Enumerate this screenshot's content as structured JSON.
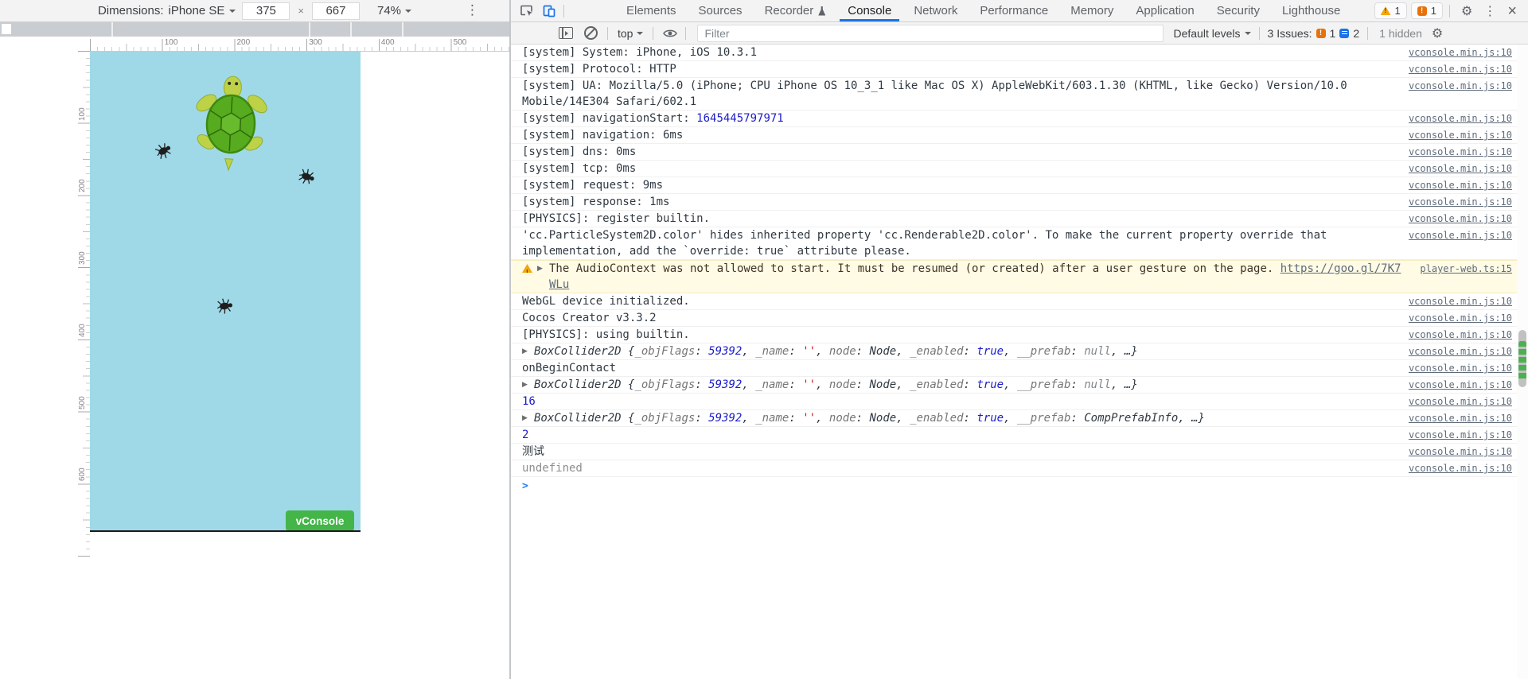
{
  "device_toolbar": {
    "dimensions_label": "Dimensions:",
    "device_name": "iPhone SE",
    "width": "375",
    "height": "667",
    "zoom": "74%",
    "x_separator": "×"
  },
  "rulers": {
    "horizontal_labels": [
      "100",
      "200",
      "300",
      "400",
      "500"
    ],
    "vertical_labels": [
      "100",
      "200",
      "300",
      "400",
      "500",
      "600"
    ]
  },
  "game": {
    "vconsole_button": "vConsole",
    "canvas_color": "#9fd9e8",
    "button_color": "#44b549"
  },
  "devtools": {
    "tabs": [
      {
        "label": "Elements"
      },
      {
        "label": "Sources"
      },
      {
        "label": "Recorder",
        "experiment": true
      },
      {
        "label": "Console",
        "active": true
      },
      {
        "label": "Network"
      },
      {
        "label": "Performance"
      },
      {
        "label": "Memory"
      },
      {
        "label": "Application"
      },
      {
        "label": "Security"
      },
      {
        "label": "Lighthouse"
      }
    ],
    "warning_badge_count": "1",
    "issues_badge_count": "1",
    "toolbar": {
      "context": "top",
      "filter_placeholder": "Filter",
      "levels": "Default levels",
      "issues_label": "3 Issues:",
      "issues_warnings": "1",
      "issues_messages": "2",
      "hidden_label": "1 hidden"
    },
    "accent_color": "#1a73e8"
  },
  "console": {
    "prompt": ">",
    "messages": [
      {
        "kind": "log",
        "parts": [
          {
            "s": "p",
            "t": "[system] System: iPhone, iOS 10.3.1"
          }
        ],
        "source": "vconsole.min.js:10"
      },
      {
        "kind": "log",
        "parts": [
          {
            "s": "p",
            "t": "[system] Protocol: HTTP"
          }
        ],
        "source": "vconsole.min.js:10"
      },
      {
        "kind": "log",
        "parts": [
          {
            "s": "p",
            "t": "[system] UA: Mozilla/5.0 (iPhone; CPU iPhone OS 10_3_1 like Mac OS X) AppleWebKit/603.1.30 (KHTML, like Gecko) Version/10.0 Mobile/14E304 Safari/602.1"
          }
        ],
        "source": "vconsole.min.js:10"
      },
      {
        "kind": "log",
        "parts": [
          {
            "s": "p",
            "t": "[system] navigationStart: "
          },
          {
            "s": "num",
            "t": "1645445797971"
          }
        ],
        "source": "vconsole.min.js:10"
      },
      {
        "kind": "log",
        "parts": [
          {
            "s": "p",
            "t": "[system] navigation: 6ms"
          }
        ],
        "source": "vconsole.min.js:10"
      },
      {
        "kind": "log",
        "parts": [
          {
            "s": "p",
            "t": "[system] dns: 0ms"
          }
        ],
        "source": "vconsole.min.js:10"
      },
      {
        "kind": "log",
        "parts": [
          {
            "s": "p",
            "t": "[system] tcp: 0ms"
          }
        ],
        "source": "vconsole.min.js:10"
      },
      {
        "kind": "log",
        "parts": [
          {
            "s": "p",
            "t": "[system] request: 9ms"
          }
        ],
        "source": "vconsole.min.js:10"
      },
      {
        "kind": "log",
        "parts": [
          {
            "s": "p",
            "t": "[system] response: 1ms"
          }
        ],
        "source": "vconsole.min.js:10"
      },
      {
        "kind": "log",
        "parts": [
          {
            "s": "p",
            "t": "[PHYSICS]: register builtin."
          }
        ],
        "source": "vconsole.min.js:10"
      },
      {
        "kind": "log",
        "parts": [
          {
            "s": "p",
            "t": "'cc.ParticleSystem2D.color' hides inherited property 'cc.Renderable2D.color'. To make the current property override that implementation, add the `override: true` attribute please."
          }
        ],
        "source": "vconsole.min.js:10"
      },
      {
        "kind": "warn",
        "arrow": true,
        "parts": [
          {
            "s": "p",
            "t": "The AudioContext was not allowed to start. It must be resumed (or created) after a user gesture on the page. "
          },
          {
            "s": "link",
            "t": "https://goo.gl/7K7WLu"
          }
        ],
        "source": "player-web.ts:15"
      },
      {
        "kind": "log",
        "parts": [
          {
            "s": "p",
            "t": "WebGL device initialized."
          }
        ],
        "source": "vconsole.min.js:10"
      },
      {
        "kind": "log",
        "parts": [
          {
            "s": "p",
            "t": "Cocos Creator v3.3.2"
          }
        ],
        "source": "vconsole.min.js:10"
      },
      {
        "kind": "log",
        "parts": [
          {
            "s": "p",
            "t": "[PHYSICS]: using builtin."
          }
        ],
        "source": "vconsole.min.js:10"
      },
      {
        "kind": "obj",
        "arrow": true,
        "parts": [
          {
            "s": "cls",
            "t": "BoxCollider2D "
          },
          {
            "s": "p",
            "t": "{"
          },
          {
            "s": "key",
            "t": "_objFlags"
          },
          {
            "s": "p",
            "t": ": "
          },
          {
            "s": "num",
            "t": "59392"
          },
          {
            "s": "p",
            "t": ", "
          },
          {
            "s": "key",
            "t": "_name"
          },
          {
            "s": "p",
            "t": ": "
          },
          {
            "s": "str",
            "t": "''"
          },
          {
            "s": "p",
            "t": ", "
          },
          {
            "s": "key",
            "t": "node"
          },
          {
            "s": "p",
            "t": ": "
          },
          {
            "s": "cls",
            "t": "Node"
          },
          {
            "s": "p",
            "t": ", "
          },
          {
            "s": "key",
            "t": "_enabled"
          },
          {
            "s": "p",
            "t": ": "
          },
          {
            "s": "num",
            "t": "true"
          },
          {
            "s": "p",
            "t": ", "
          },
          {
            "s": "key",
            "t": "__prefab"
          },
          {
            "s": "p",
            "t": ": "
          },
          {
            "s": "nul",
            "t": "null"
          },
          {
            "s": "p",
            "t": ", …}"
          }
        ],
        "source": "vconsole.min.js:10"
      },
      {
        "kind": "log",
        "parts": [
          {
            "s": "p",
            "t": "onBeginContact"
          }
        ],
        "source": "vconsole.min.js:10"
      },
      {
        "kind": "obj",
        "arrow": true,
        "parts": [
          {
            "s": "cls",
            "t": "BoxCollider2D "
          },
          {
            "s": "p",
            "t": "{"
          },
          {
            "s": "key",
            "t": "_objFlags"
          },
          {
            "s": "p",
            "t": ": "
          },
          {
            "s": "num",
            "t": "59392"
          },
          {
            "s": "p",
            "t": ", "
          },
          {
            "s": "key",
            "t": "_name"
          },
          {
            "s": "p",
            "t": ": "
          },
          {
            "s": "str",
            "t": "''"
          },
          {
            "s": "p",
            "t": ", "
          },
          {
            "s": "key",
            "t": "node"
          },
          {
            "s": "p",
            "t": ": "
          },
          {
            "s": "cls",
            "t": "Node"
          },
          {
            "s": "p",
            "t": ", "
          },
          {
            "s": "key",
            "t": "_enabled"
          },
          {
            "s": "p",
            "t": ": "
          },
          {
            "s": "num",
            "t": "true"
          },
          {
            "s": "p",
            "t": ", "
          },
          {
            "s": "key",
            "t": "__prefab"
          },
          {
            "s": "p",
            "t": ": "
          },
          {
            "s": "nul",
            "t": "null"
          },
          {
            "s": "p",
            "t": ", …}"
          }
        ],
        "source": "vconsole.min.js:10"
      },
      {
        "kind": "log",
        "parts": [
          {
            "s": "num",
            "t": "16"
          }
        ],
        "source": "vconsole.min.js:10"
      },
      {
        "kind": "obj",
        "arrow": true,
        "parts": [
          {
            "s": "cls",
            "t": "BoxCollider2D "
          },
          {
            "s": "p",
            "t": "{"
          },
          {
            "s": "key",
            "t": "_objFlags"
          },
          {
            "s": "p",
            "t": ": "
          },
          {
            "s": "num",
            "t": "59392"
          },
          {
            "s": "p",
            "t": ", "
          },
          {
            "s": "key",
            "t": "_name"
          },
          {
            "s": "p",
            "t": ": "
          },
          {
            "s": "str",
            "t": "''"
          },
          {
            "s": "p",
            "t": ", "
          },
          {
            "s": "key",
            "t": "node"
          },
          {
            "s": "p",
            "t": ": "
          },
          {
            "s": "cls",
            "t": "Node"
          },
          {
            "s": "p",
            "t": ", "
          },
          {
            "s": "key",
            "t": "_enabled"
          },
          {
            "s": "p",
            "t": ": "
          },
          {
            "s": "num",
            "t": "true"
          },
          {
            "s": "p",
            "t": ", "
          },
          {
            "s": "key",
            "t": "__prefab"
          },
          {
            "s": "p",
            "t": ": "
          },
          {
            "s": "cls",
            "t": "CompPrefabInfo"
          },
          {
            "s": "p",
            "t": ", …}"
          }
        ],
        "source": "vconsole.min.js:10"
      },
      {
        "kind": "log",
        "parts": [
          {
            "s": "num",
            "t": "2"
          }
        ],
        "source": "vconsole.min.js:10"
      },
      {
        "kind": "log",
        "parts": [
          {
            "s": "p",
            "t": "测试"
          }
        ],
        "source": "vconsole.min.js:10"
      },
      {
        "kind": "log",
        "parts": [
          {
            "s": "mut",
            "t": "undefined"
          }
        ],
        "source": "vconsole.min.js:10"
      }
    ]
  }
}
